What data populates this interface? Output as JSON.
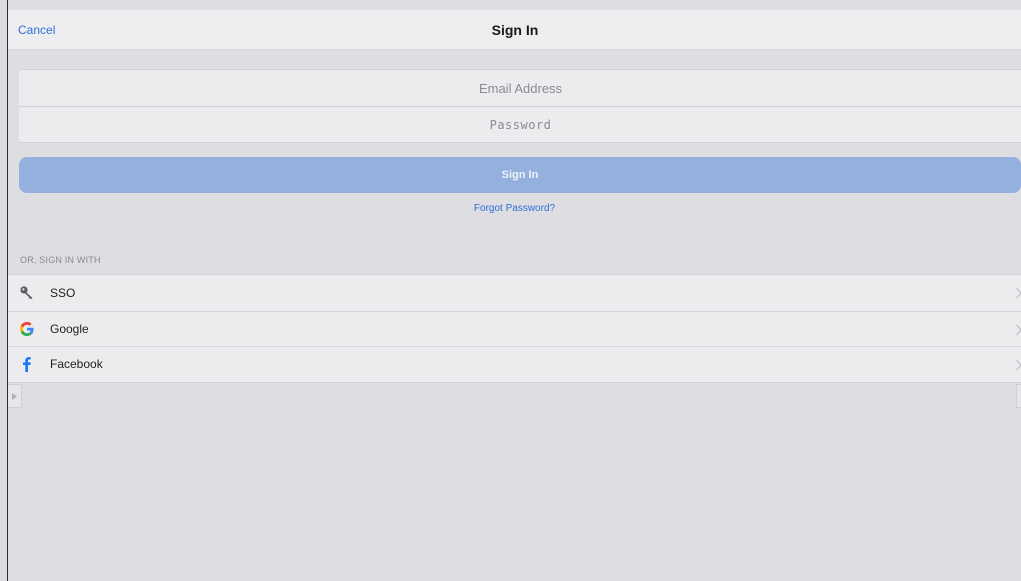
{
  "navbar": {
    "cancel_label": "Cancel",
    "title": "Sign In"
  },
  "form": {
    "email_placeholder": "Email Address",
    "password_placeholder": "Password",
    "signin_label": "Sign In",
    "forgot_label": "Forgot Password?"
  },
  "providers": {
    "section_label": "OR, SIGN IN WITH",
    "items": [
      {
        "label": "SSO",
        "icon": "key-icon"
      },
      {
        "label": "Google",
        "icon": "google-icon"
      },
      {
        "label": "Facebook",
        "icon": "facebook-icon"
      }
    ]
  },
  "colors": {
    "accent": "#2f6fd6",
    "signin_button": "#93b1dc",
    "facebook": "#1877f2"
  }
}
